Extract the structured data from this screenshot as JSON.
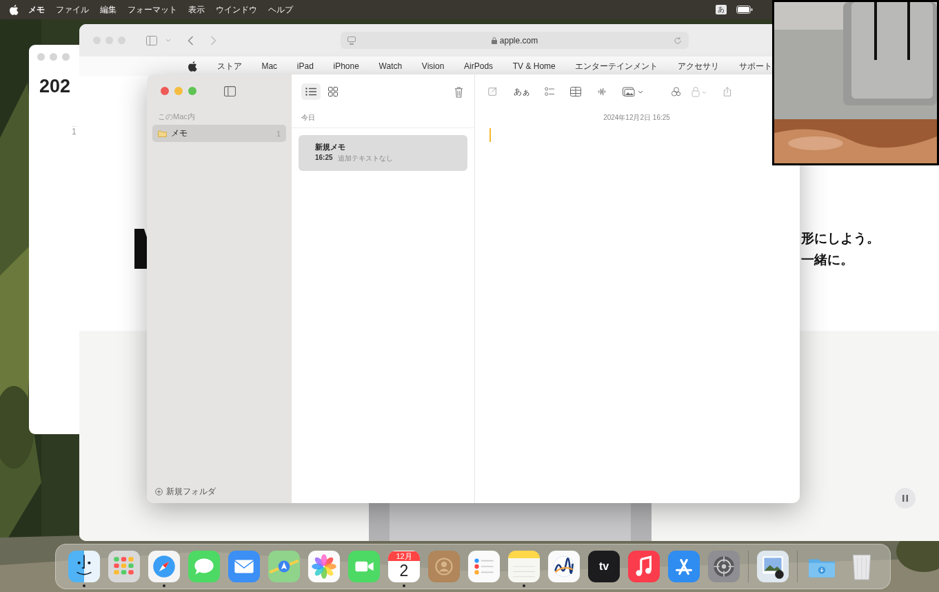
{
  "menu_bar": {
    "items": [
      {
        "label": "メモ",
        "kind": "app"
      },
      {
        "label": "ファイル",
        "kind": "menu"
      },
      {
        "label": "編集",
        "kind": "menu"
      },
      {
        "label": "フォーマット",
        "kind": "menu"
      },
      {
        "label": "表示",
        "kind": "menu"
      },
      {
        "label": "ウインドウ",
        "kind": "menu"
      },
      {
        "label": "ヘルプ",
        "kind": "menu"
      }
    ],
    "input_source": "あ"
  },
  "calendar_window": {
    "year": "202",
    "column_label": "1"
  },
  "safari": {
    "url": "apple.com",
    "nav_links": [
      "ストア",
      "Mac",
      "iPad",
      "iPhone",
      "Watch",
      "Vision",
      "AirPods",
      "TV & Home",
      "エンターテインメント",
      "アクセサリ",
      "サポート"
    ],
    "tagline_lines": [
      "形にしよう。",
      "一緒に。"
    ]
  },
  "notes": {
    "sidebar": {
      "section": "このMac内",
      "folders": [
        {
          "name": "メモ",
          "count": "1",
          "selected": true
        }
      ],
      "new_folder": "新規フォルダ"
    },
    "list": {
      "views": [
        {
          "kind": "list",
          "selected": true
        },
        {
          "kind": "gallery",
          "selected": false
        }
      ],
      "section": "今日",
      "items": [
        {
          "title": "新規メモ",
          "time": "16:25",
          "preview": "追加テキストなし",
          "selected": true
        }
      ]
    },
    "editor": {
      "format_label": "あぁ",
      "date": "2024年12月2日 16:25"
    }
  },
  "dock": {
    "apps": [
      {
        "kind": "finder",
        "running": true
      },
      {
        "kind": "launchpad",
        "running": false
      },
      {
        "kind": "safari",
        "running": true
      },
      {
        "kind": "messages",
        "running": false
      },
      {
        "kind": "mail",
        "running": false
      },
      {
        "kind": "maps",
        "running": false
      },
      {
        "kind": "photos",
        "running": false
      },
      {
        "kind": "facetime",
        "running": false
      },
      {
        "kind": "calendar",
        "running": true,
        "month": "12月",
        "day": "2"
      },
      {
        "kind": "contacts",
        "running": false
      },
      {
        "kind": "reminders",
        "running": false
      },
      {
        "kind": "notes",
        "running": true
      },
      {
        "kind": "freeform",
        "running": false
      },
      {
        "kind": "tv",
        "running": false,
        "label": "tv"
      },
      {
        "kind": "music",
        "running": false
      },
      {
        "kind": "appstore",
        "running": false
      },
      {
        "kind": "settings",
        "running": false
      },
      {
        "kind": "separator"
      },
      {
        "kind": "preview",
        "running": false
      },
      {
        "kind": "separator"
      },
      {
        "kind": "downloads",
        "running": false
      },
      {
        "kind": "trash",
        "running": false
      }
    ]
  }
}
